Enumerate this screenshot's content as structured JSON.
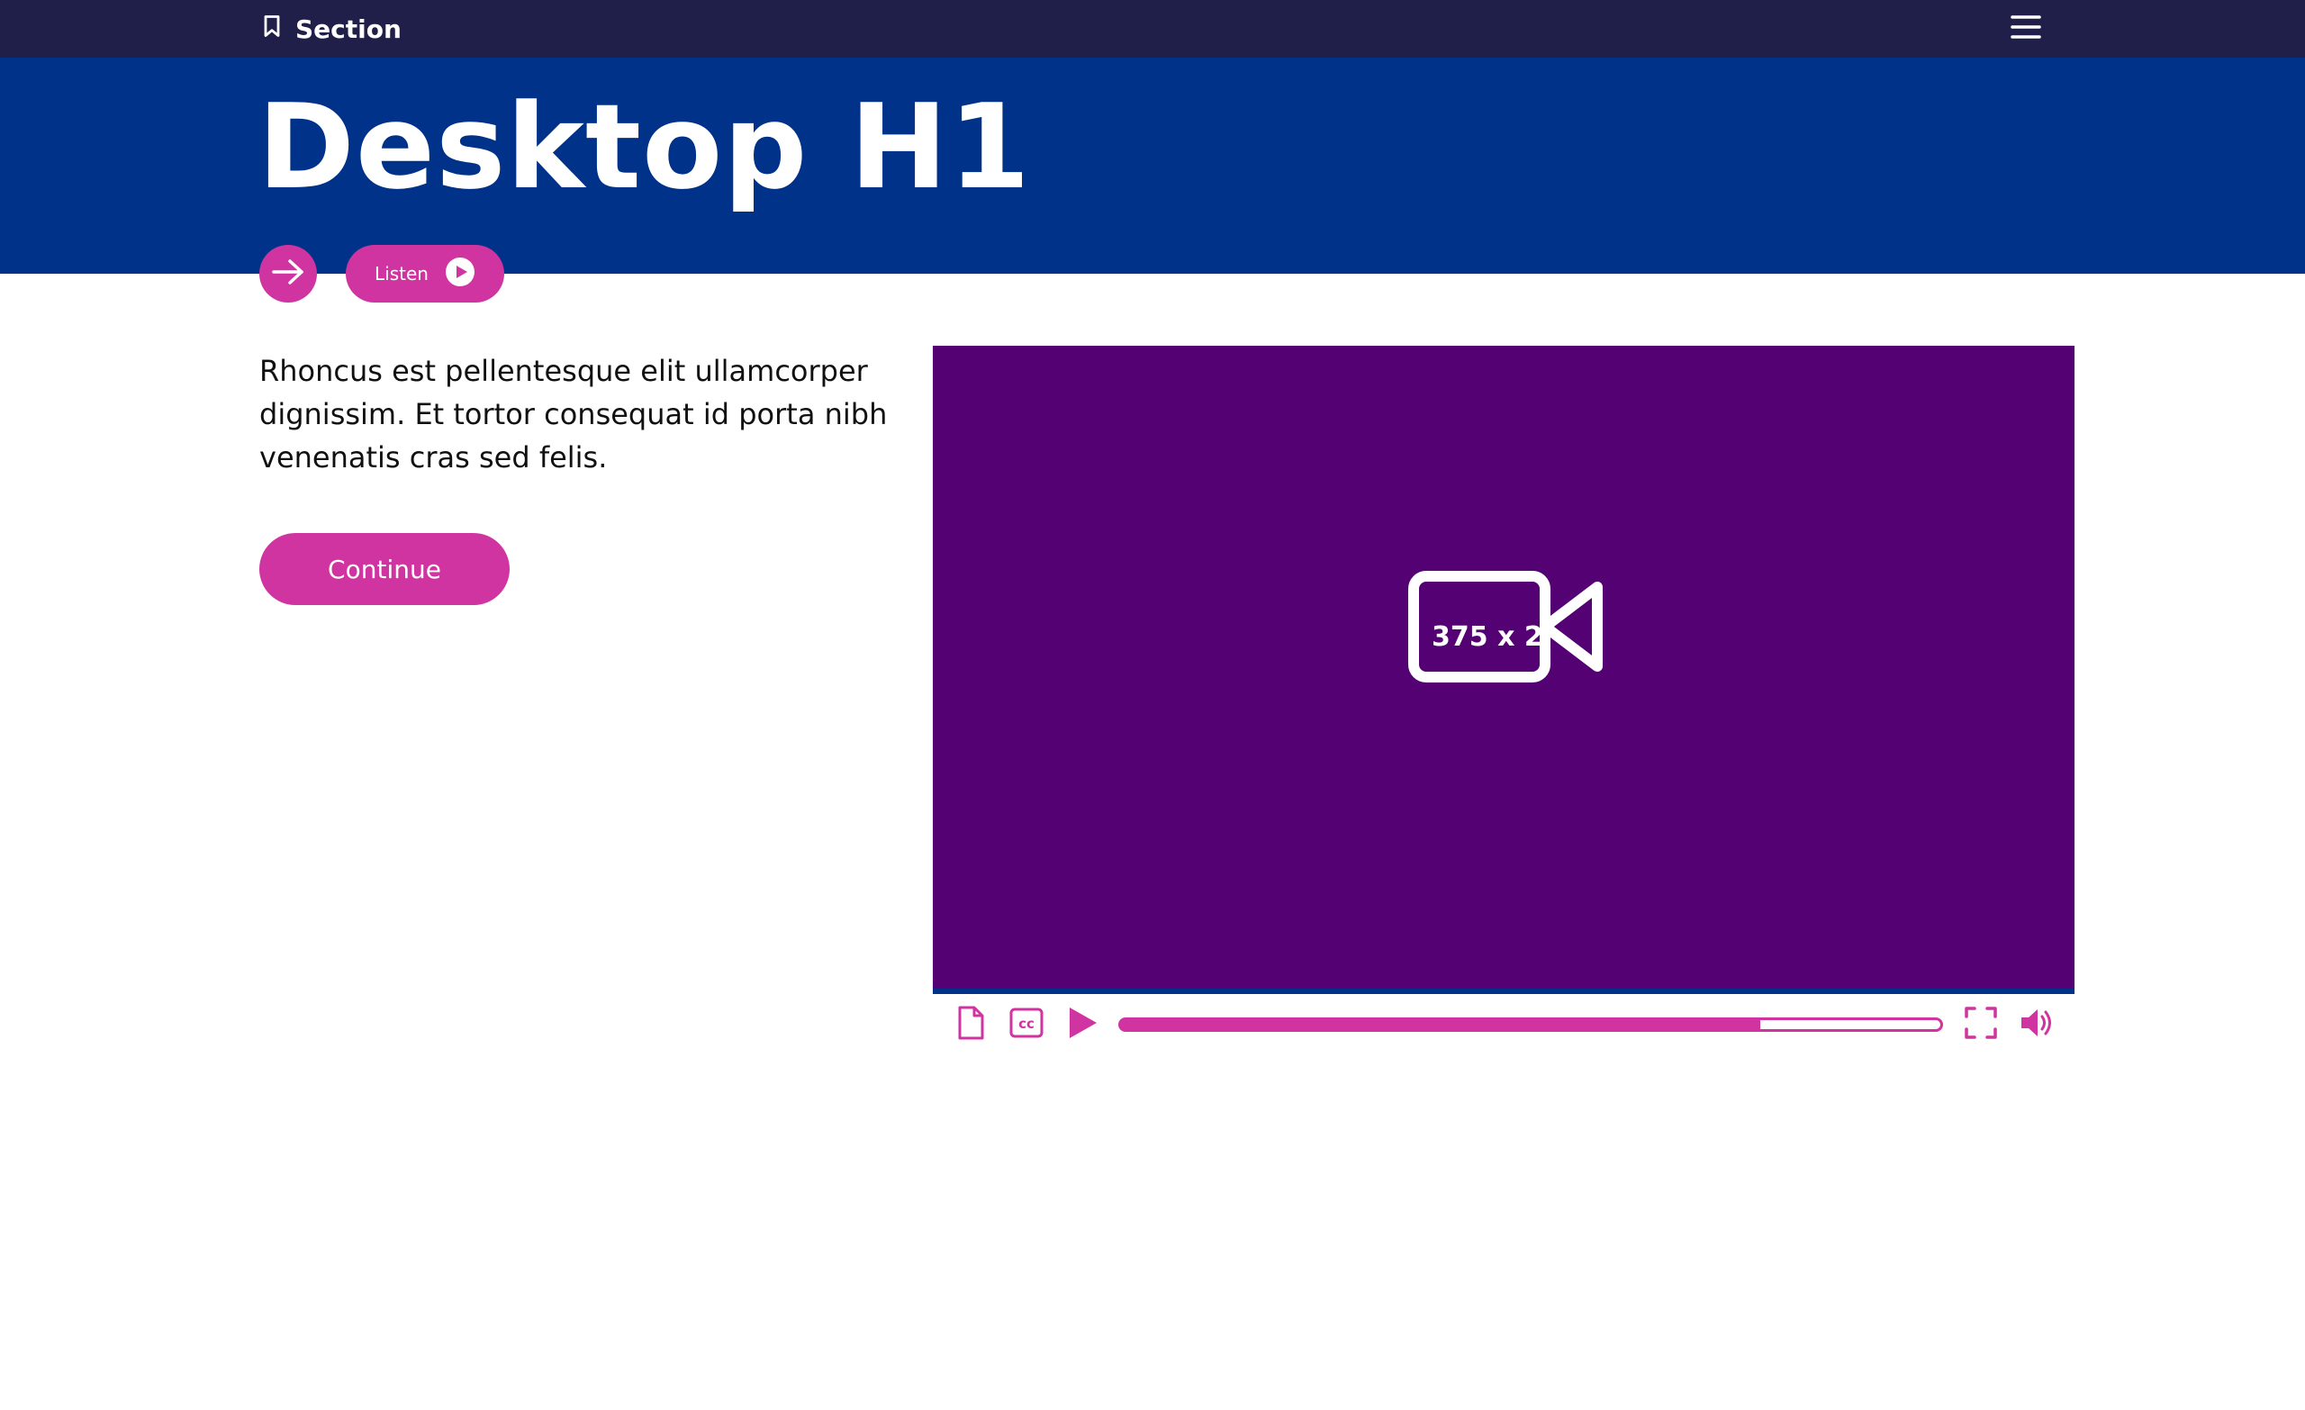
{
  "topbar": {
    "section_label": "Section",
    "section_icon": "bookmark-icon",
    "menu_icon": "hamburger-menu-icon"
  },
  "hero": {
    "title": "Desktop H1"
  },
  "actions": {
    "arrow_icon": "arrow-right-icon",
    "listen_label": "Listen",
    "listen_icon": "play-circle-icon"
  },
  "content": {
    "body": "Rhoncus est pellentesque elit ullamcorper dignissim. Et tortor consequat id porta nibh venenatis cras sed felis.",
    "continue_label": "Continue"
  },
  "video": {
    "placeholder_icon": "video-camera-icon",
    "placeholder_label": "375 x 2",
    "controls": {
      "transcript_icon": "document-icon",
      "captions_icon": "closed-captions-icon",
      "play_icon": "play-icon",
      "progress": 0.78,
      "fullscreen_icon": "fullscreen-icon",
      "volume_icon": "volume-icon"
    }
  },
  "colors": {
    "topbar": "#1f1f49",
    "hero": "#003289",
    "accent": "#cf34a0",
    "video_bg": "#540174"
  }
}
